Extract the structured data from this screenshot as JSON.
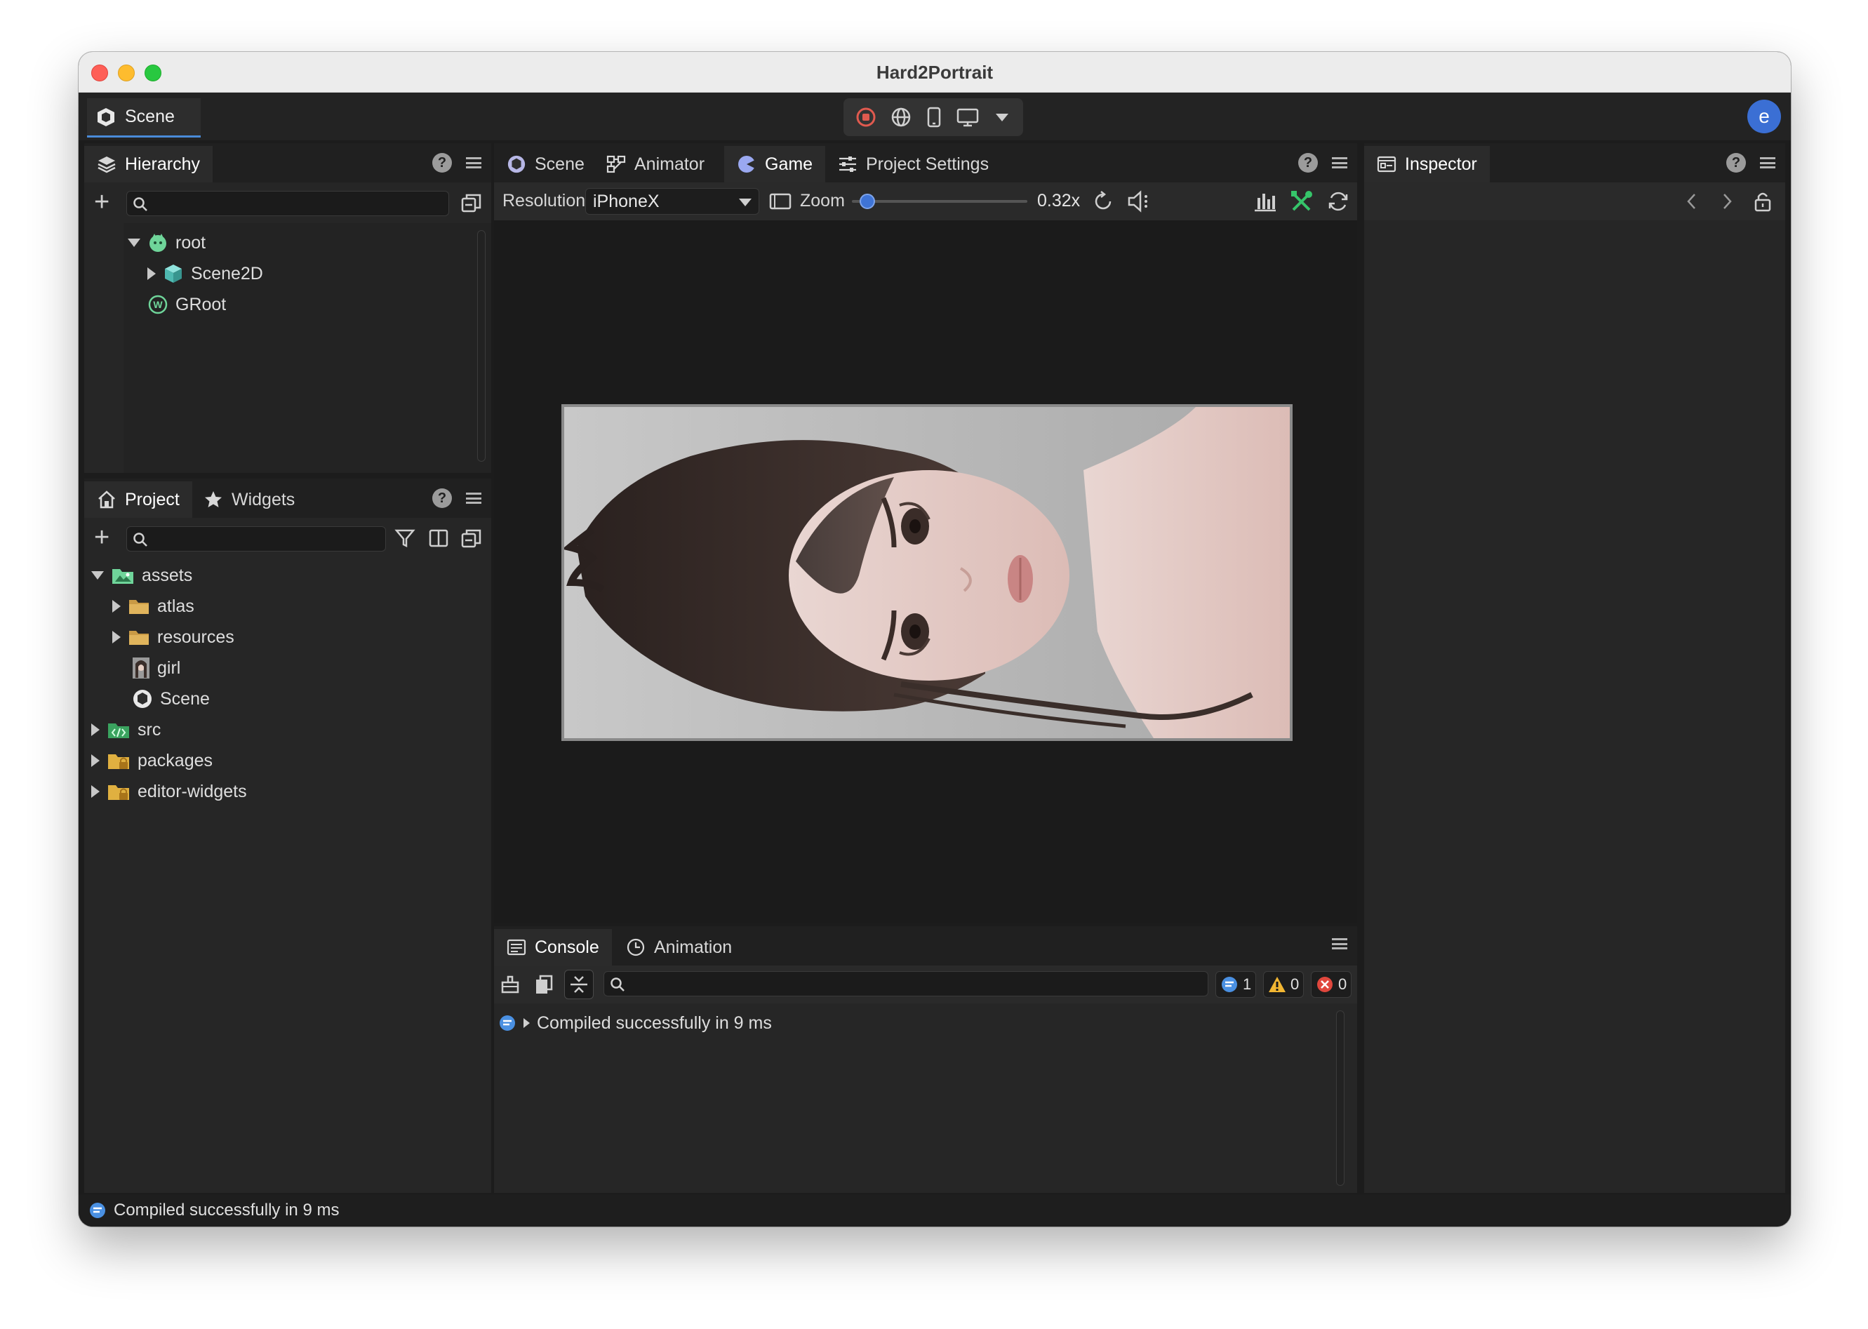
{
  "window": {
    "title": "Hard2Portrait"
  },
  "toolbar": {
    "scene_tab": "Scene",
    "avatar_letter": "e"
  },
  "hierarchy": {
    "tab": "Hierarchy",
    "items": [
      {
        "label": "root"
      },
      {
        "label": "Scene2D"
      },
      {
        "label": "GRoot"
      }
    ]
  },
  "project": {
    "tabs": [
      "Project",
      "Widgets"
    ],
    "items": [
      {
        "label": "assets"
      },
      {
        "label": "atlas"
      },
      {
        "label": "resources"
      },
      {
        "label": "girl"
      },
      {
        "label": "Scene"
      },
      {
        "label": "src"
      },
      {
        "label": "packages"
      },
      {
        "label": "editor-widgets"
      }
    ]
  },
  "center": {
    "tabs": [
      "Scene",
      "Animator",
      "Game",
      "Project Settings"
    ],
    "active_tab": "Game",
    "resolution_label": "Resolution",
    "resolution_value": "iPhoneX",
    "zoom_label": "Zoom",
    "zoom_value": "0.32x",
    "zoom_level": 0.05
  },
  "inspector": {
    "tab": "Inspector"
  },
  "console": {
    "tabs": [
      "Console",
      "Animation"
    ],
    "log_count": "1",
    "warn_count": "0",
    "error_count": "0",
    "messages": [
      "Compiled successfully in 9 ms"
    ]
  },
  "status": {
    "message": "Compiled successfully in 9 ms"
  },
  "colors": {
    "accent": "#4a8bd8",
    "avatar": "#3b6fd4",
    "tools_green": "#36c56a"
  }
}
